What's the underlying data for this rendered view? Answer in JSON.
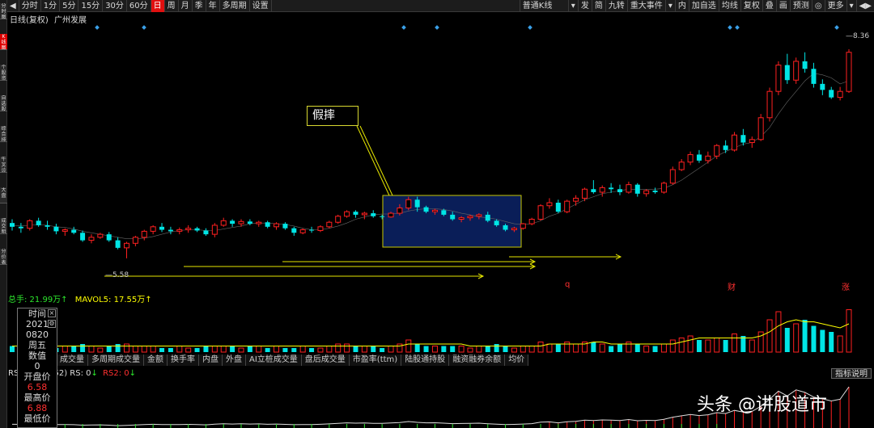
{
  "left_tabs": [
    "分时图",
    "K线图",
    "个股资料",
    "自选股",
    "综合排名",
    "牛叉诊股",
    "大盘",
    "成交明细",
    "分价表"
  ],
  "toolbar": {
    "items": [
      "分时",
      "1分",
      "5分",
      "15分",
      "30分",
      "60分",
      "日",
      "周",
      "月",
      "季",
      "年",
      "多周期",
      "设置"
    ],
    "active_index": 6,
    "right": [
      "普通K线",
      "▾",
      "发",
      "简",
      "九转",
      "重大事件",
      "▾",
      "内",
      "加自选",
      "均线",
      "复权",
      "叠",
      "画",
      "预测",
      "◎",
      "更多",
      "▾"
    ]
  },
  "chart_title": {
    "period": "日线(复权)",
    "stock": "广州发展"
  },
  "price_labels": {
    "high": "8.36",
    "low": "5.58"
  },
  "annotation": {
    "label": "假摔"
  },
  "event_marks": [
    "q",
    "财",
    "涨"
  ],
  "volume_header": {
    "label": "总手: 21.99万↑",
    "mavol_label": "MAVOL5: 17.55万↑"
  },
  "mid_tabs": [
    "成交量",
    "多周期成交量",
    "金额",
    "换手率",
    "内盘",
    "外盘",
    "AI立桩成交量",
    "盘后成交量",
    "市盈率(ttm)",
    "陆股通持股",
    "融资融券余额",
    "均价"
  ],
  "indicator_header": {
    "prefix": "RS",
    "mid": "52) RS: 0",
    "rs2": "RS2: 0",
    "rs2_arrow": "↓",
    "arrow": "↓"
  },
  "indicator_button": "指标说明",
  "info_box": {
    "time_label": "时间",
    "year": "2021",
    "date": "0820",
    "weekday": "周五",
    "value_label": "数值",
    "value": "0",
    "open_label": "开盘价",
    "open": "6.58",
    "high_label": "最高价",
    "high": "6.88",
    "low_label": "最低价"
  },
  "watermark": "头条 @讲股道市",
  "colors": {
    "up": "#ff2020",
    "down": "#00e5e5",
    "ma": "#ffff00",
    "box_fill": "#0a1e58",
    "box_border": "#c8c800",
    "arrow": "#e6e600"
  },
  "chart_data": {
    "type": "candlestick",
    "price_range": [
      5.3,
      8.5
    ],
    "candles": [
      [
        6.05,
        6.1,
        5.95,
        6.0
      ],
      [
        6.0,
        6.05,
        5.92,
        5.98
      ],
      [
        5.98,
        6.1,
        5.95,
        6.08
      ],
      [
        6.08,
        6.12,
        6.0,
        6.02
      ],
      [
        6.02,
        6.08,
        5.96,
        6.0
      ],
      [
        6.0,
        6.04,
        5.9,
        5.94
      ],
      [
        5.94,
        5.98,
        5.88,
        5.96
      ],
      [
        5.96,
        6.0,
        5.9,
        5.92
      ],
      [
        5.92,
        5.95,
        5.8,
        5.82
      ],
      [
        5.82,
        5.9,
        5.78,
        5.86
      ],
      [
        5.86,
        5.92,
        5.84,
        5.9
      ],
      [
        5.9,
        5.93,
        5.8,
        5.82
      ],
      [
        5.82,
        5.86,
        5.7,
        5.72
      ],
      [
        5.72,
        5.8,
        5.58,
        5.78
      ],
      [
        5.78,
        5.88,
        5.74,
        5.86
      ],
      [
        5.86,
        5.96,
        5.82,
        5.94
      ],
      [
        5.94,
        6.02,
        5.9,
        6.0
      ],
      [
        6.0,
        6.05,
        5.93,
        5.96
      ],
      [
        5.96,
        6.0,
        5.9,
        5.94
      ],
      [
        5.94,
        5.99,
        5.9,
        5.96
      ],
      [
        5.96,
        6.02,
        5.92,
        5.98
      ],
      [
        5.98,
        6.0,
        5.93,
        5.95
      ],
      [
        5.95,
        5.98,
        5.88,
        5.9
      ],
      [
        5.9,
        6.05,
        5.86,
        6.02
      ],
      [
        6.02,
        6.12,
        6.0,
        6.08
      ],
      [
        6.08,
        6.1,
        6.0,
        6.04
      ],
      [
        6.04,
        6.1,
        6.0,
        6.07
      ],
      [
        6.07,
        6.1,
        6.02,
        6.04
      ],
      [
        6.04,
        6.08,
        6.0,
        6.06
      ],
      [
        6.06,
        6.08,
        5.98,
        6.0
      ],
      [
        6.0,
        6.06,
        5.96,
        6.04
      ],
      [
        6.04,
        6.06,
        5.96,
        5.98
      ],
      [
        5.98,
        6.0,
        5.88,
        5.92
      ],
      [
        5.92,
        5.98,
        5.9,
        5.96
      ],
      [
        5.96,
        6.0,
        5.92,
        5.95
      ],
      [
        5.95,
        6.02,
        5.93,
        6.0
      ],
      [
        6.0,
        6.08,
        5.98,
        6.06
      ],
      [
        6.06,
        6.16,
        6.04,
        6.14
      ],
      [
        6.14,
        6.22,
        6.12,
        6.2
      ],
      [
        6.2,
        6.22,
        6.12,
        6.16
      ],
      [
        6.16,
        6.2,
        6.1,
        6.18
      ],
      [
        6.18,
        6.22,
        6.12,
        6.14
      ],
      [
        6.14,
        6.16,
        6.1,
        6.13
      ],
      [
        6.13,
        6.2,
        6.12,
        6.18
      ],
      [
        6.18,
        6.3,
        6.15,
        6.25
      ],
      [
        6.25,
        6.4,
        6.22,
        6.36
      ],
      [
        6.36,
        6.4,
        6.2,
        6.26
      ],
      [
        6.26,
        6.28,
        6.18,
        6.2
      ],
      [
        6.2,
        6.24,
        6.16,
        6.22
      ],
      [
        6.22,
        6.24,
        6.14,
        6.16
      ],
      [
        6.16,
        6.2,
        6.08,
        6.1
      ],
      [
        6.1,
        6.14,
        6.06,
        6.12
      ],
      [
        6.12,
        6.16,
        6.08,
        6.14
      ],
      [
        6.14,
        6.18,
        6.1,
        6.16
      ],
      [
        6.16,
        6.2,
        6.06,
        6.08
      ],
      [
        6.08,
        6.1,
        6.0,
        6.02
      ],
      [
        6.02,
        6.04,
        5.94,
        5.96
      ],
      [
        5.96,
        6.0,
        5.93,
        5.98
      ],
      [
        5.98,
        6.05,
        5.96,
        6.04
      ],
      [
        6.04,
        6.12,
        6.02,
        6.1
      ],
      [
        6.1,
        6.3,
        6.08,
        6.28
      ],
      [
        6.28,
        6.38,
        6.24,
        6.32
      ],
      [
        6.32,
        6.36,
        6.18,
        6.2
      ],
      [
        6.2,
        6.36,
        6.18,
        6.34
      ],
      [
        6.34,
        6.42,
        6.28,
        6.38
      ],
      [
        6.38,
        6.52,
        6.34,
        6.5
      ],
      [
        6.5,
        6.62,
        6.44,
        6.46
      ],
      [
        6.46,
        6.55,
        6.4,
        6.52
      ],
      [
        6.52,
        6.58,
        6.45,
        6.5
      ],
      [
        6.5,
        6.56,
        6.42,
        6.46
      ],
      [
        6.46,
        6.6,
        6.44,
        6.56
      ],
      [
        6.56,
        6.58,
        6.4,
        6.44
      ],
      [
        6.44,
        6.5,
        6.4,
        6.48
      ],
      [
        6.48,
        6.52,
        6.44,
        6.46
      ],
      [
        6.46,
        6.6,
        6.44,
        6.58
      ],
      [
        6.58,
        6.8,
        6.56,
        6.76
      ],
      [
        6.76,
        6.9,
        6.74,
        6.86
      ],
      [
        6.86,
        7.0,
        6.82,
        6.96
      ],
      [
        6.96,
        7.02,
        6.85,
        6.88
      ],
      [
        6.88,
        7.0,
        6.84,
        6.94
      ],
      [
        6.94,
        7.1,
        6.9,
        7.08
      ],
      [
        7.08,
        7.15,
        6.98,
        7.02
      ],
      [
        7.02,
        7.26,
        7.0,
        7.22
      ],
      [
        7.22,
        7.3,
        7.08,
        7.12
      ],
      [
        7.12,
        7.2,
        7.05,
        7.16
      ],
      [
        7.16,
        7.5,
        7.14,
        7.45
      ],
      [
        7.45,
        7.85,
        7.4,
        7.8
      ],
      [
        7.8,
        8.2,
        7.75,
        8.15
      ],
      [
        8.15,
        8.3,
        7.9,
        7.95
      ],
      [
        7.95,
        8.25,
        7.9,
        8.2
      ],
      [
        8.2,
        8.32,
        8.05,
        8.1
      ],
      [
        8.1,
        8.18,
        7.85,
        7.9
      ],
      [
        7.9,
        7.96,
        7.75,
        7.82
      ],
      [
        7.82,
        7.86,
        7.7,
        7.72
      ],
      [
        7.72,
        7.86,
        7.68,
        7.8
      ],
      [
        7.8,
        8.36,
        7.78,
        8.32
      ]
    ],
    "ma_line": [
      6.02,
      6.01,
      6.02,
      6.03,
      6.02,
      6.0,
      5.99,
      5.97,
      5.94,
      5.92,
      5.9,
      5.88,
      5.86,
      5.84,
      5.84,
      5.85,
      5.87,
      5.9,
      5.93,
      5.95,
      5.96,
      5.96,
      5.95,
      5.95,
      5.97,
      5.99,
      6.01,
      6.04,
      6.05,
      6.05,
      6.04,
      6.03,
      6.01,
      5.98,
      5.96,
      5.96,
      5.98,
      6.01,
      6.05,
      6.1,
      6.13,
      6.16,
      6.17,
      6.17,
      6.18,
      6.21,
      6.23,
      6.24,
      6.24,
      6.23,
      6.21,
      6.18,
      6.16,
      6.13,
      6.12,
      6.1,
      6.07,
      6.04,
      6.03,
      6.04,
      6.08,
      6.14,
      6.18,
      6.24,
      6.3,
      6.36,
      6.4,
      6.44,
      6.46,
      6.48,
      6.5,
      6.5,
      6.5,
      6.5,
      6.51,
      6.56,
      6.62,
      6.7,
      6.78,
      6.86,
      6.94,
      7.0,
      7.05,
      7.1,
      7.12,
      7.2,
      7.32,
      7.5,
      7.66,
      7.8,
      7.94,
      8.04,
      8.02,
      7.98,
      7.9,
      7.94
    ],
    "volumes": [
      3,
      4,
      3,
      3,
      3,
      2,
      3,
      3,
      4,
      3,
      2,
      3,
      4,
      4,
      3,
      3,
      3,
      2,
      2,
      3,
      2,
      2,
      3,
      3,
      3,
      3,
      2,
      3,
      3,
      2,
      3,
      2,
      2,
      3,
      2,
      2,
      3,
      4,
      4,
      3,
      3,
      3,
      2,
      3,
      4,
      6,
      4,
      3,
      3,
      3,
      3,
      3,
      2,
      3,
      3,
      4,
      3,
      2,
      3,
      3,
      5,
      4,
      4,
      5,
      4,
      5,
      5,
      4,
      3,
      4,
      5,
      4,
      3,
      3,
      4,
      6,
      7,
      8,
      6,
      6,
      7,
      6,
      9,
      8,
      6,
      10,
      16,
      20,
      12,
      14,
      16,
      13,
      11,
      10,
      8,
      21
    ],
    "vol_ma": [
      3,
      3,
      3,
      3,
      3,
      3,
      3,
      3,
      3,
      3,
      3,
      3,
      3,
      3,
      3,
      3,
      3,
      3,
      3,
      3,
      3,
      3,
      3,
      3,
      3,
      3,
      3,
      3,
      3,
      3,
      3,
      3,
      3,
      3,
      3,
      3,
      3,
      3,
      3,
      3,
      3,
      3,
      3,
      3,
      3,
      4,
      4,
      4,
      4,
      4,
      4,
      4,
      3,
      3,
      3,
      3,
      3,
      3,
      3,
      3,
      3,
      4,
      4,
      4,
      4,
      4,
      5,
      5,
      4,
      4,
      4,
      4,
      4,
      4,
      4,
      4,
      5,
      6,
      7,
      7,
      7,
      7,
      7,
      7,
      7,
      8,
      10,
      13,
      15,
      16,
      15,
      15,
      14,
      13,
      12,
      14
    ]
  }
}
